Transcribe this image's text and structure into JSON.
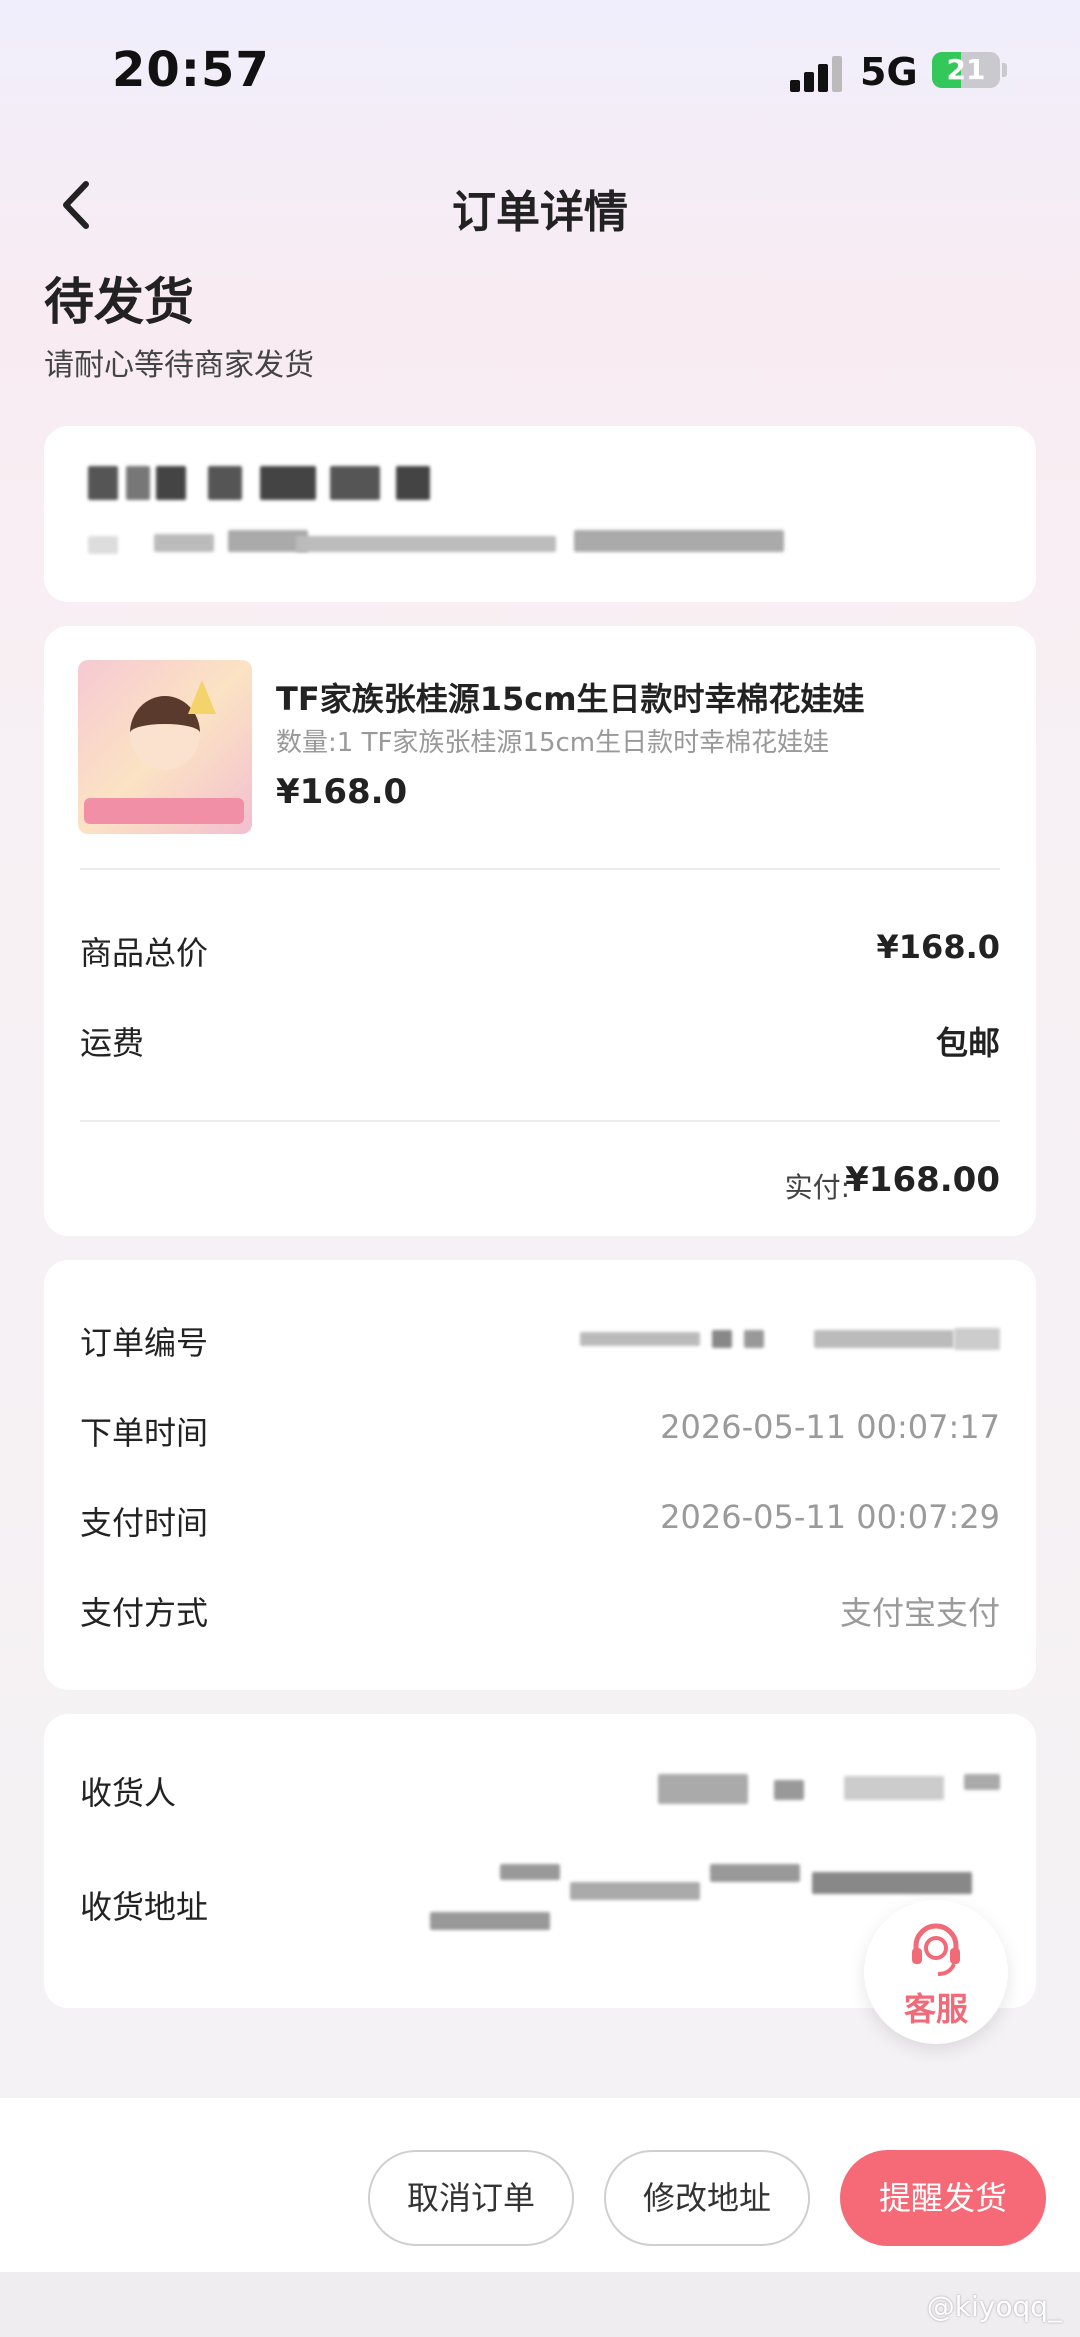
{
  "status_bar": {
    "time": "20:57",
    "network": "5G",
    "battery_level": "21",
    "battery_fraction": 0.21,
    "signal_icon": "signal-bars-icon",
    "battery_icon": "battery-charging-icon"
  },
  "header": {
    "title": "订单详情",
    "back_icon": "chevron-left-icon"
  },
  "order_status": {
    "title": "待发货",
    "subtitle": "请耐心等待商家发货"
  },
  "product": {
    "name": "TF家族张桂源15cm生日款时幸棉花娃娃",
    "spec": "数量:1 TF家族张桂源15cm生日款时幸棉花娃娃",
    "price": "¥168.0"
  },
  "price_summary": {
    "goods_total_label": "商品总价",
    "goods_total_value": "¥168.0",
    "shipping_label": "运费",
    "shipping_value": "包邮",
    "paid_label": "实付:",
    "paid_value": "¥168.00"
  },
  "order_info": {
    "order_no_label": "订单编号",
    "order_time_label": "下单时间",
    "order_time_value": "2026-05-11 00:07:17",
    "pay_time_label": "支付时间",
    "pay_time_value": "2026-05-11 00:07:29",
    "pay_method_label": "支付方式",
    "pay_method_value": "支付宝支付"
  },
  "shipping_info": {
    "receiver_label": "收货人",
    "address_label": "收货地址"
  },
  "customer_service": {
    "label": "客服",
    "icon": "headset-icon"
  },
  "actions": {
    "cancel_label": "取消订单",
    "modify_address_label": "修改地址",
    "remind_label": "提醒发货"
  },
  "colors": {
    "accent": "#f66a77",
    "service_text": "#f06a78",
    "battery_green": "#34c759"
  },
  "watermark": "@kiyoqq_"
}
